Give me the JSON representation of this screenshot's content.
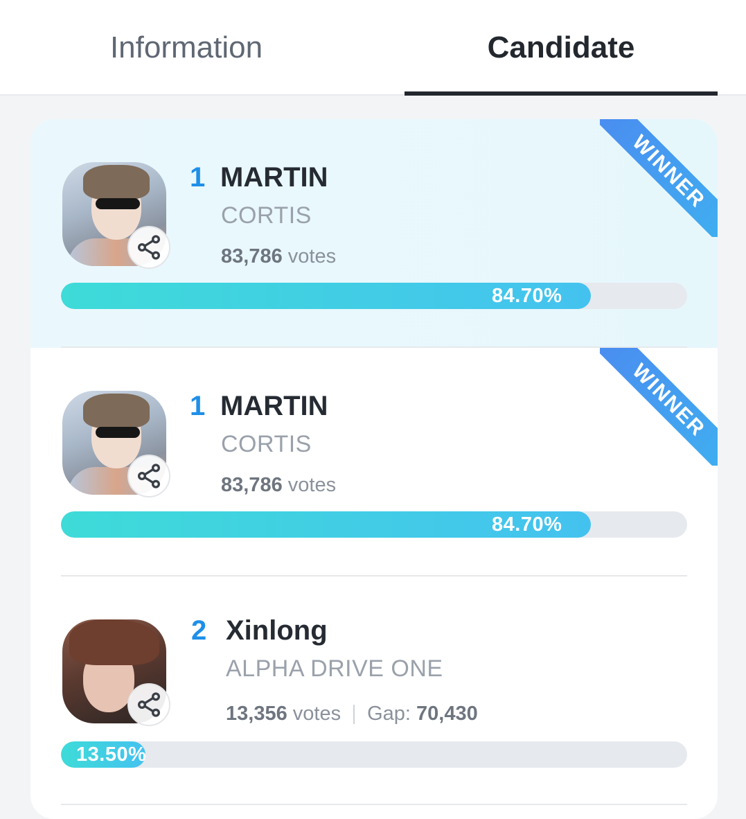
{
  "tabs": [
    {
      "label": "Information",
      "active": false
    },
    {
      "label": "Candidate",
      "active": true
    }
  ],
  "colors": {
    "accent": "#1e8fe8",
    "bar_start": "#3edbd8",
    "bar_end": "#44c2ef",
    "ribbon": "#4a8cf0"
  },
  "candidates": [
    {
      "rank": "1",
      "name": "MARTIN",
      "group": "CORTIS",
      "votes_count": "83,786",
      "votes_label": "votes",
      "percent_label": "84.70%",
      "percent": 84.7,
      "badge": "WINNER",
      "avatar_icon": "avatar",
      "share_icon": "share-icon"
    },
    {
      "rank": "1",
      "name": "MARTIN",
      "group": "CORTIS",
      "votes_count": "83,786",
      "votes_label": "votes",
      "percent_label": "84.70%",
      "percent": 84.7,
      "badge": "WINNER",
      "avatar_icon": "avatar",
      "share_icon": "share-icon"
    },
    {
      "rank": "2",
      "name": "Xinlong",
      "group": "ALPHA DRIVE ONE",
      "votes_count": "13,356",
      "votes_label": "votes",
      "gap_label": "Gap:",
      "gap_value": "70,430",
      "percent_label": "13.50%",
      "percent": 13.5,
      "avatar_icon": "avatar",
      "share_icon": "share-icon"
    }
  ]
}
